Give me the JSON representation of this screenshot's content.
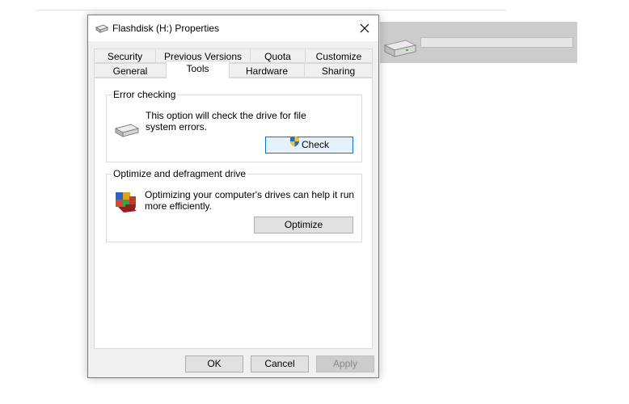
{
  "dialog": {
    "title": "Flashdisk (H:) Properties",
    "icons": {
      "title": "drive-icon",
      "close": "close-icon"
    }
  },
  "tabs": {
    "row1": [
      "Security",
      "Previous Versions",
      "Quota",
      "Customize"
    ],
    "row2": [
      "General",
      "Tools",
      "Hardware",
      "Sharing"
    ],
    "active": "Tools"
  },
  "error_checking": {
    "title": "Error checking",
    "description_line1": "This option will check the drive for file",
    "description_line2": "system errors.",
    "button": "Check",
    "icons": {
      "group": "drive-icon",
      "button": "uac-shield-icon"
    }
  },
  "optimize": {
    "title": "Optimize and defragment drive",
    "description_line1": "Optimizing your computer's drives can help it run",
    "description_line2": "more efficiently.",
    "button": "Optimize",
    "icons": {
      "group": "defrag-icon"
    }
  },
  "footer": {
    "ok": "OK",
    "cancel": "Cancel",
    "apply": "Apply"
  },
  "colors": {
    "focus_border": "#0078d7",
    "selected_row": "#cccccc"
  }
}
